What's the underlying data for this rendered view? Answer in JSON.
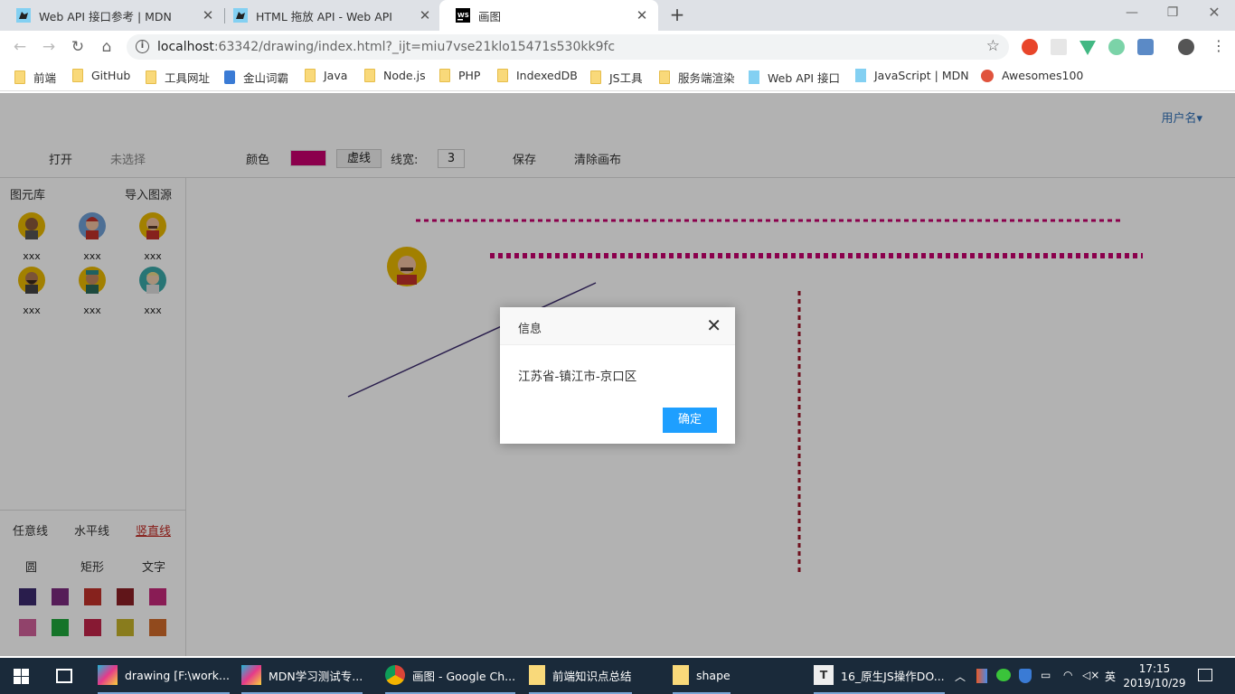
{
  "browser": {
    "tabs": [
      {
        "title": "Web API 接口参考 | MDN",
        "icon": "mdn-dino-icon"
      },
      {
        "title": "HTML 拖放 API - Web API 接口",
        "icon": "mdn-dino-icon"
      },
      {
        "title": "画图",
        "icon": "webstorm-icon",
        "active": true
      }
    ],
    "address": {
      "host": "localhost",
      "rest": ":63342/drawing/index.html?_ijt=miu7vse21klo15471s530kk9fc"
    },
    "bookmarks": [
      {
        "label": "前端",
        "icon": "folder-icon"
      },
      {
        "label": "GitHub",
        "icon": "folder-icon"
      },
      {
        "label": "工具网址",
        "icon": "folder-icon"
      },
      {
        "label": "金山词霸",
        "icon": "person-icon"
      },
      {
        "label": "Java",
        "icon": "folder-icon"
      },
      {
        "label": "Node.js",
        "icon": "folder-icon"
      },
      {
        "label": "PHP",
        "icon": "folder-icon"
      },
      {
        "label": "IndexedDB",
        "icon": "folder-icon"
      },
      {
        "label": "JS工具",
        "icon": "folder-icon"
      },
      {
        "label": "服务端渲染",
        "icon": "folder-icon"
      },
      {
        "label": "Web API 接口",
        "icon": "mdn-dino-icon"
      },
      {
        "label": "JavaScript | MDN",
        "icon": "mdn-dino-icon"
      },
      {
        "label": "Awesomes100",
        "icon": "awesomes-icon"
      }
    ]
  },
  "app": {
    "user": "用户名▾",
    "open": "打开",
    "file_status": "未选择",
    "color_label": "颜色",
    "color_value": "#c8006e",
    "dash_button": "虚线",
    "line_width_label": "线宽:",
    "line_width": "3",
    "save": "保存",
    "clear": "清除画布",
    "library_title": "图元库",
    "import": "导入图源",
    "avatars": [
      "xxx",
      "xxx",
      "xxx",
      "xxx",
      "xxx",
      "xxx"
    ],
    "tools_row1": [
      "任意线",
      "水平线",
      "竖直线"
    ],
    "tools_row2": [
      "圆",
      "矩形",
      "文字"
    ],
    "selected_tool": "竖直线",
    "swatches": [
      "#3b2a6e",
      "#7b2a7e",
      "#c0322a",
      "#8a1f24",
      "#c4297a",
      "#d0609a",
      "#1fa63c",
      "#c2244a",
      "#c4b22a",
      "#d06a2a"
    ]
  },
  "dialog": {
    "title": "信息",
    "message": "江苏省-镇江市-京口区",
    "ok": "确定"
  },
  "taskbar": {
    "items": [
      {
        "label": "drawing [F:\\work...",
        "icon": "webstorm-icon"
      },
      {
        "label": "MDN学习测试专...",
        "icon": "webstorm-icon"
      },
      {
        "label": "画图 - Google Ch...",
        "icon": "chrome-icon"
      },
      {
        "label": "前端知识点总结",
        "icon": "folder-icon"
      },
      {
        "label": "shape",
        "icon": "folder-icon"
      },
      {
        "label": "16_原生JS操作DO...",
        "icon": "typora-icon"
      }
    ],
    "ime": "英",
    "time": "17:15",
    "date": "2019/10/29"
  }
}
